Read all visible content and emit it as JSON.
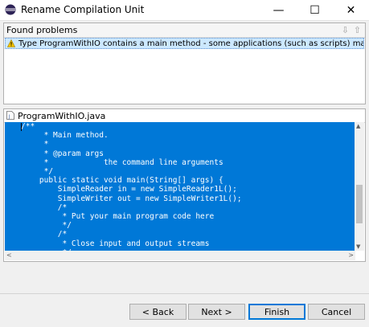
{
  "window": {
    "title": "Rename Compilation Unit",
    "controls": {
      "minimize": "—",
      "maximize": "☐",
      "close": "✕"
    }
  },
  "problems": {
    "header": "Found problems",
    "items": [
      {
        "icon": "warning-icon",
        "text": "Type ProgramWithIO contains a main method - some applications (such as scripts) may not work after refactoring"
      }
    ]
  },
  "editor": {
    "file_name": "ProgramWithIO.java",
    "code": "/**\n     * Main method.\n     *\n     * @param args\n     *            the command line arguments\n     */\n    public static void main(String[] args) {\n        SimpleReader in = new SimpleReader1L();\n        SimpleWriter out = new SimpleWriter1L();\n        /*\n         * Put your main program code here\n         */\n        /*\n         * Close input and output streams\n         */"
  },
  "buttons": {
    "back": "< Back",
    "next": "Next >",
    "finish": "Finish",
    "cancel": "Cancel"
  },
  "colors": {
    "selection": "#0078d7",
    "problem_highlight": "#cce8ff"
  }
}
